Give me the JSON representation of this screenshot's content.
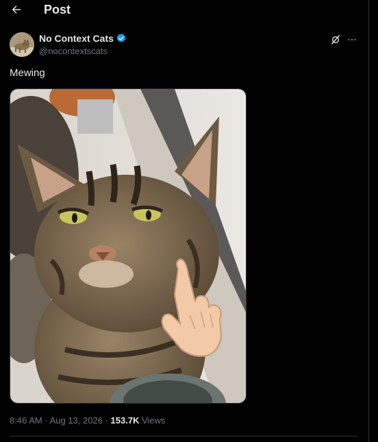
{
  "header": {
    "title": "Post",
    "back_icon": "arrow-left-icon"
  },
  "author": {
    "display_name": "No Context Cats",
    "handle": "@nocontextscats",
    "verified": true,
    "verified_color": "#1d9bf0"
  },
  "actions": {
    "grok_icon": "grok-icon",
    "more_icon": "more-horizontal-icon"
  },
  "post": {
    "text": "Mewing",
    "media_description_icon": "cat-photo"
  },
  "meta": {
    "time": "8:46 AM",
    "separator": "·",
    "date": "Aug 13, 2026",
    "views_count": "153.7K",
    "views_label": "Views"
  },
  "colors": {
    "background": "#000000",
    "primary_text": "#e7e9ea",
    "secondary_text": "#71767b",
    "border": "#2f3336",
    "accent": "#1d9bf0"
  }
}
